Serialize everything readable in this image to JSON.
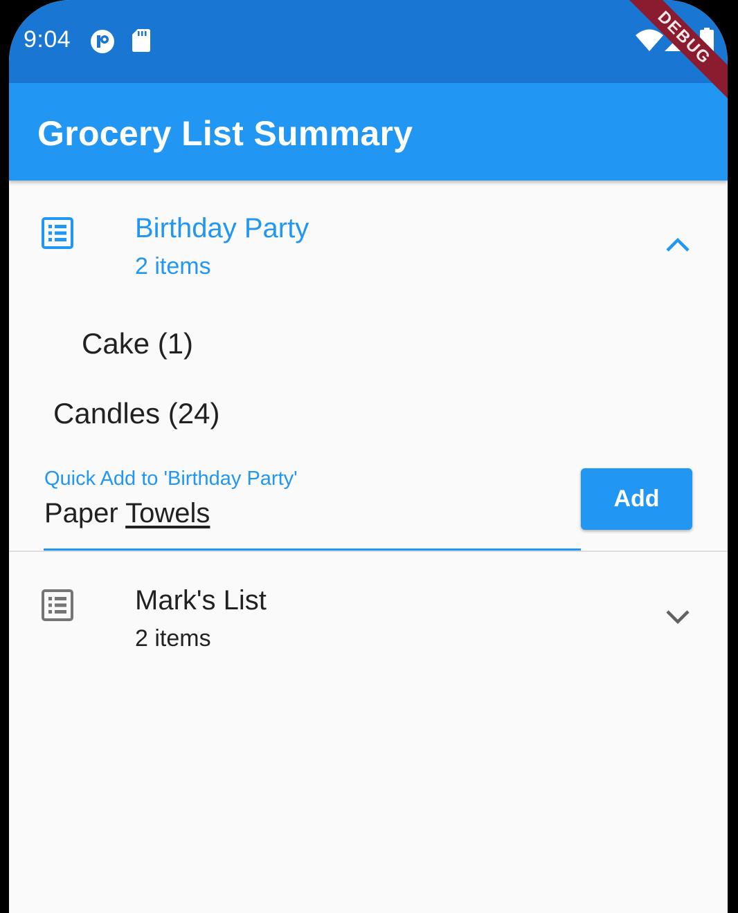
{
  "status_bar": {
    "time": "9:04",
    "icons": [
      "app-notification-icon",
      "sd-card-icon",
      "wifi-icon",
      "signal-icon",
      "battery-icon"
    ]
  },
  "app_bar": {
    "title": "Grocery List Summary",
    "debug_label": "DEBUG"
  },
  "lists": [
    {
      "title": "Birthday Party",
      "subtitle": "2 items",
      "expanded": true,
      "icon": "list-icon",
      "entries": [
        "Cake (1)",
        "Candles (24)"
      ],
      "quick_add": {
        "label": "Quick Add to 'Birthday Party'",
        "value_prefix": "Paper ",
        "value_underlined": "Towels",
        "button_label": "Add"
      }
    },
    {
      "title": "Mark's List",
      "subtitle": "2 items",
      "expanded": false,
      "icon": "list-icon"
    }
  ],
  "colors": {
    "status_bar": "#1976d2",
    "primary": "#2196f3",
    "text": "#212121",
    "icon_inactive": "#757575",
    "background": "#fafafa",
    "debug_banner": "#8b1c2f"
  }
}
